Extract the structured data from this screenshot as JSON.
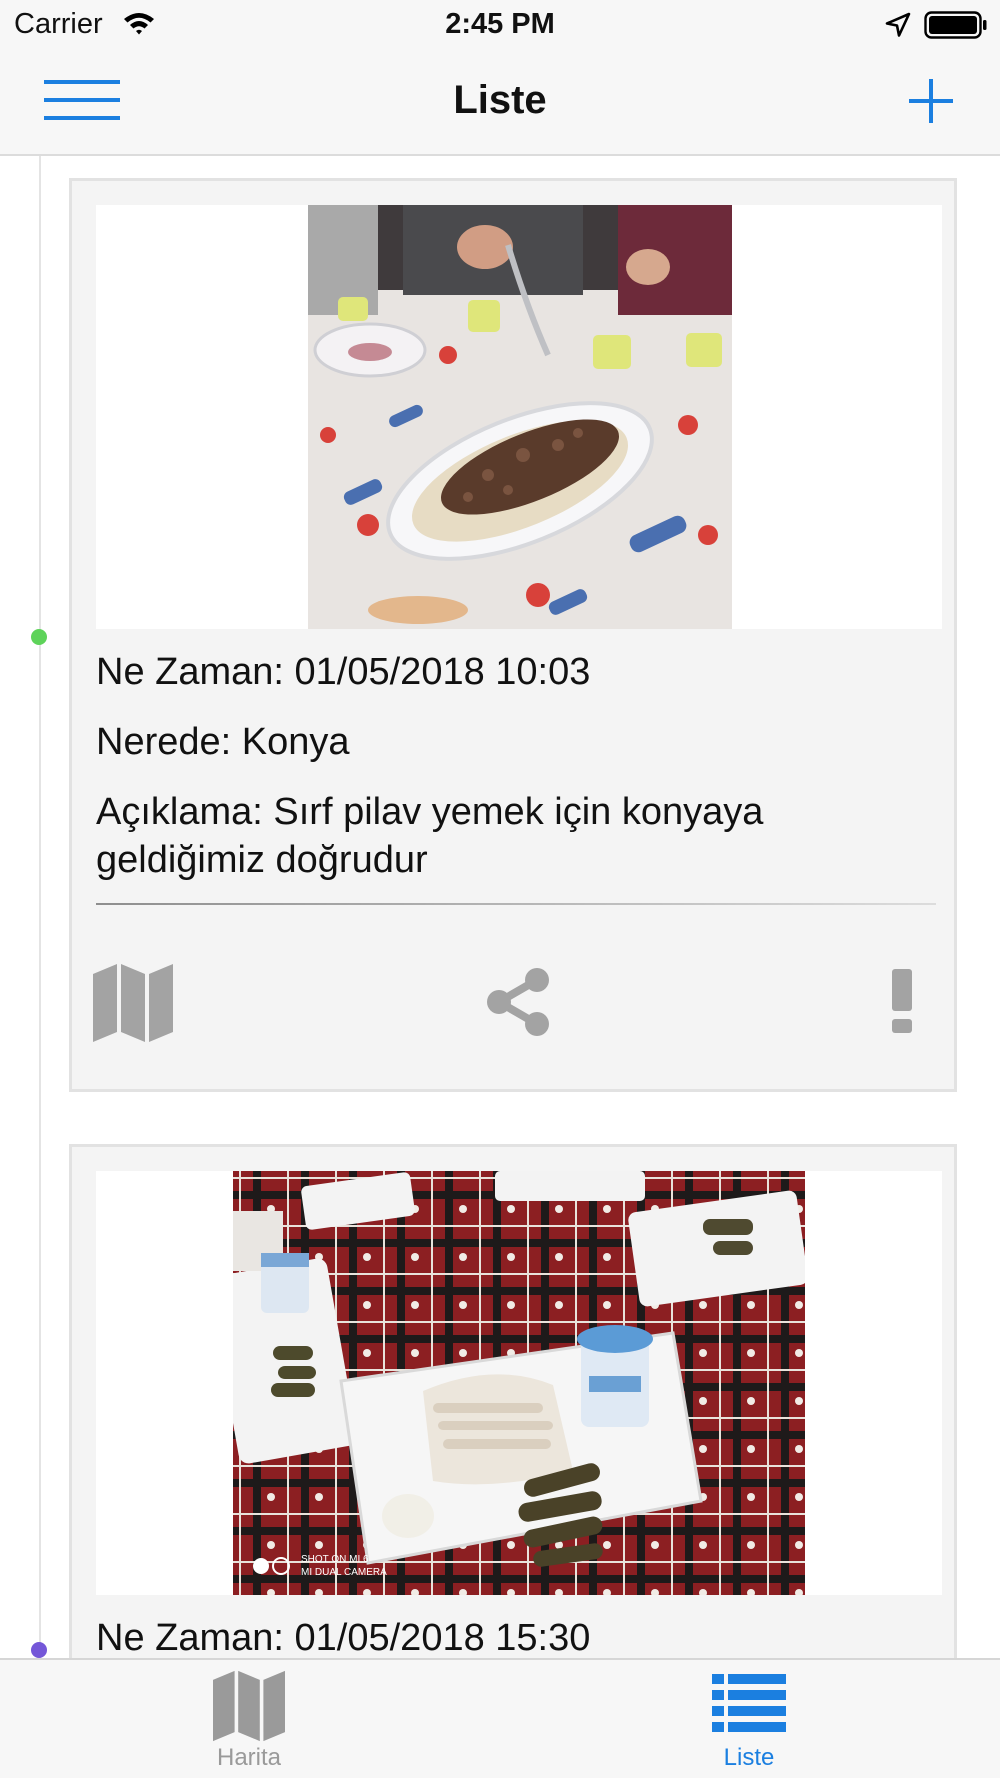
{
  "status_bar": {
    "carrier": "Carrier",
    "time": "2:45 PM",
    "wifi_icon": "wifi-icon",
    "location_icon": "location-arrow-icon",
    "battery_icon": "battery-full-icon"
  },
  "nav": {
    "title": "Liste",
    "left_icon": "hamburger-menu-icon",
    "right_icon": "plus-icon"
  },
  "feed": [
    {
      "photo": "plate of rice pilaf topped with meat on a printed tablecloth",
      "when_label": "Ne Zaman:",
      "when": "01/05/2018 10:03",
      "where_label": "Nerede:",
      "where": "Konya",
      "desc_label": "Açıklama:",
      "desc": "Sırf pilav yemek için konyaya geldiğimiz doğrudur",
      "actions": [
        "map-icon",
        "share-icon",
        "exclamation-icon"
      ],
      "timeline_dot_color": "#5ed35a"
    },
    {
      "photo": "white tray with rice, shredded chicken and stuffed grape leaves on a red checkered tablecloth",
      "photo_watermark": "SHOT ON MI 6\nMI DUAL CAMERA",
      "when_label": "Ne Zaman:",
      "when": "01/05/2018 15:30",
      "timeline_dot_color": "#7457d8"
    }
  ],
  "tab_bar": {
    "tabs": [
      {
        "label": "Harita",
        "icon": "map-icon",
        "selected": false
      },
      {
        "label": "Liste",
        "icon": "list-icon",
        "selected": true
      }
    ]
  },
  "colors": {
    "accent": "#1b7fe0",
    "inactive": "#9a9a9a",
    "card_background": "#f4f4f4",
    "bar_background": "#f7f7f7"
  }
}
